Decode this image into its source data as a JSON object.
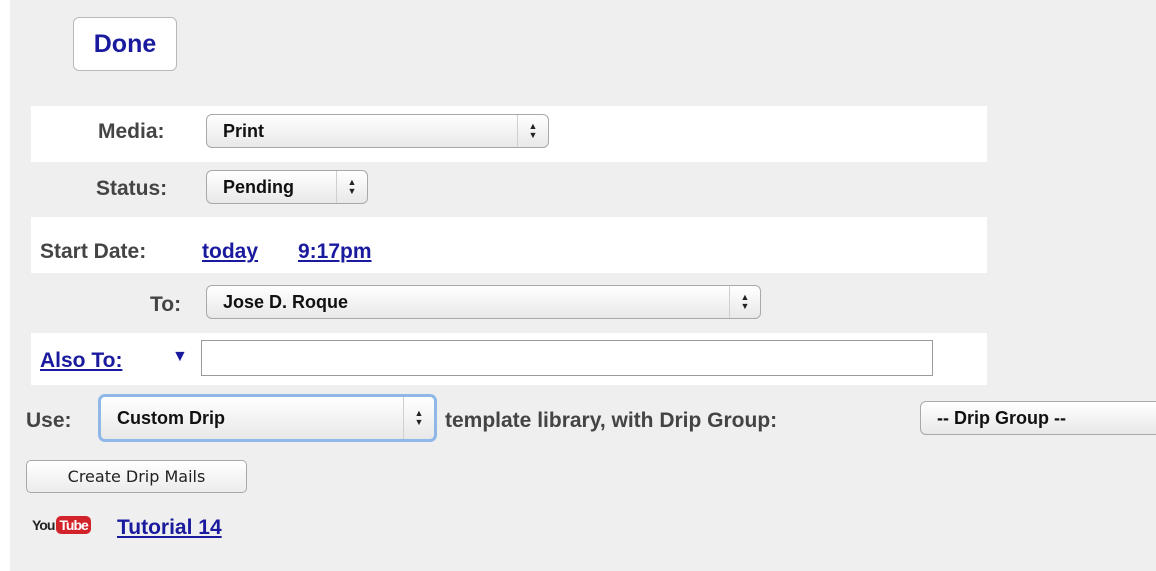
{
  "header": {
    "done_label": "Done"
  },
  "form": {
    "media": {
      "label": "Media:",
      "value": "Print"
    },
    "status": {
      "label": "Status:",
      "value": "Pending"
    },
    "start_date": {
      "label": "Start Date:",
      "date_link": "today",
      "time_link": "9:17pm"
    },
    "to": {
      "label": "To:",
      "value": "Jose D. Roque"
    },
    "also_to": {
      "label": "Also To:",
      "arrow": "▼",
      "value": ""
    },
    "use": {
      "label": "Use:",
      "value": "Custom Drip",
      "suffix": "template library, with Drip Group:",
      "drip_group_value": "-- Drip Group --"
    }
  },
  "actions": {
    "create_drip_label": "Create Drip Mails"
  },
  "tutorial": {
    "logo_you": "You",
    "logo_tube": "Tube",
    "link_text": "Tutorial 14",
    "icon": "youtube-logo-icon"
  },
  "colors": {
    "link": "#1a1a9e",
    "label": "#444444",
    "panel_bg": "#efefef",
    "focus": "#8fb8e8"
  }
}
